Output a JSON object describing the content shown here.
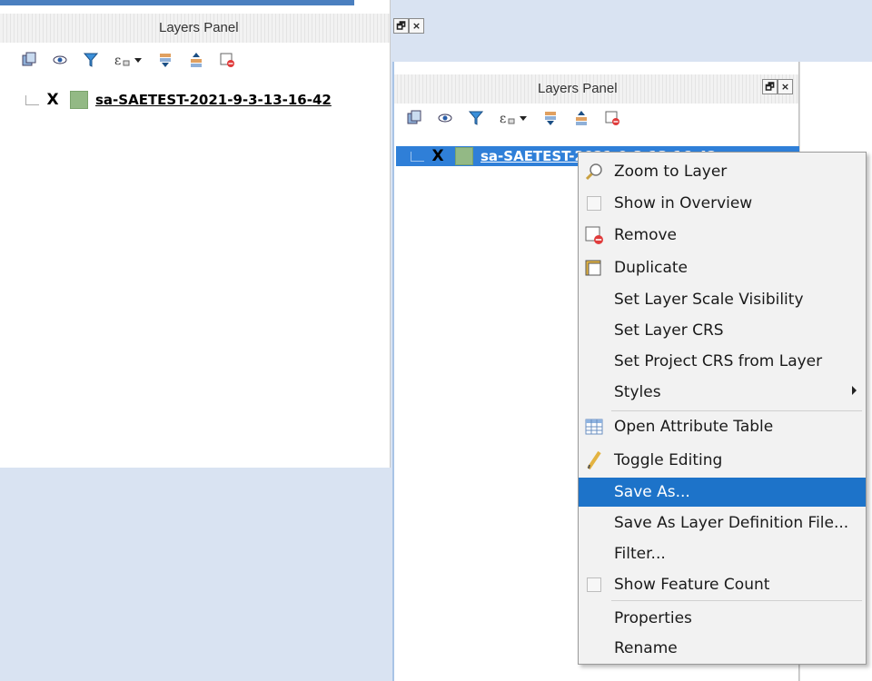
{
  "left_panel": {
    "title": "Layers Panel",
    "layer": {
      "checkbox": "X",
      "name": "sa-SAETEST-2021-9-3-13-16-42"
    },
    "buttons": {
      "float": "🗗",
      "close": "×"
    }
  },
  "right_panel": {
    "title": "Layers Panel",
    "layer": {
      "checkbox": "X",
      "name": "sa-SAETEST-2021-9-3-13-16-42"
    },
    "buttons": {
      "float": "🗗",
      "close": "×"
    }
  },
  "toolbar_icons": [
    "add-group-icon",
    "manage-visibility-icon",
    "filter-icon",
    "expression-filter-icon",
    "expand-all-icon",
    "collapse-all-icon",
    "remove-layer-icon"
  ],
  "context_menu": {
    "items": [
      {
        "label": "Zoom to Layer",
        "icon": "magnifier-icon"
      },
      {
        "label": "Show in Overview",
        "icon": "checkbox-icon"
      },
      {
        "label": "Remove",
        "icon": "remove-layer-icon"
      },
      {
        "label": "Duplicate",
        "icon": "duplicate-icon"
      },
      {
        "label": "Set Layer Scale Visibility"
      },
      {
        "label": "Set Layer CRS"
      },
      {
        "label": "Set Project CRS from Layer"
      },
      {
        "label": "Styles",
        "submenu": true
      },
      {
        "label": "Open Attribute Table",
        "icon": "table-icon"
      },
      {
        "label": "Toggle Editing",
        "icon": "pencil-icon"
      },
      {
        "label": "Save As...",
        "highlighted": true
      },
      {
        "label": "Save As Layer Definition File..."
      },
      {
        "label": "Filter..."
      },
      {
        "label": "Show Feature Count",
        "icon": "checkbox-icon"
      },
      {
        "label": "Properties"
      },
      {
        "label": "Rename"
      }
    ]
  },
  "colors": {
    "selection": "#2f7fd8",
    "menu_highlight": "#1d73c9",
    "background": "#d9e3f2",
    "layer_swatch": "#93b985"
  }
}
